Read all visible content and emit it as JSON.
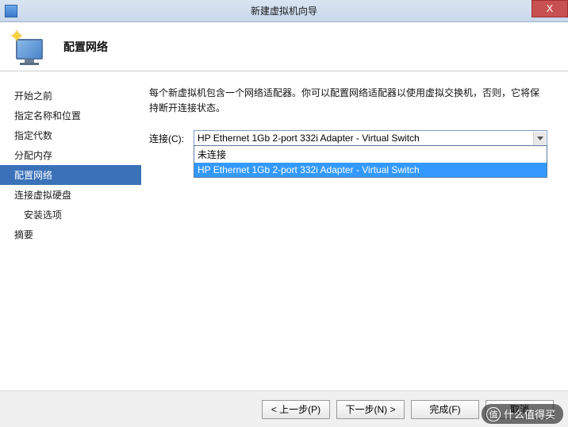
{
  "titlebar": {
    "title": "新建虚拟机向导",
    "close": "X"
  },
  "header": {
    "title": "配置网络"
  },
  "sidebar": {
    "items": [
      {
        "label": "开始之前",
        "indent": false,
        "active": false
      },
      {
        "label": "指定名称和位置",
        "indent": false,
        "active": false
      },
      {
        "label": "指定代数",
        "indent": false,
        "active": false
      },
      {
        "label": "分配内存",
        "indent": false,
        "active": false
      },
      {
        "label": "配置网络",
        "indent": false,
        "active": true
      },
      {
        "label": "连接虚拟硬盘",
        "indent": false,
        "active": false
      },
      {
        "label": "安装选项",
        "indent": true,
        "active": false
      },
      {
        "label": "摘要",
        "indent": false,
        "active": false
      }
    ]
  },
  "main": {
    "description": "每个新虚拟机包含一个网络适配器。你可以配置网络适配器以使用虚拟交换机，否则，它将保持断开连接状态。",
    "connection_label": "连接(C):",
    "connection_value": "HP Ethernet 1Gb 2-port 332i Adapter - Virtual Switch",
    "dropdown_options": [
      {
        "label": "未连接",
        "selected": false
      },
      {
        "label": "HP Ethernet 1Gb 2-port 332i Adapter - Virtual Switch",
        "selected": true
      }
    ]
  },
  "footer": {
    "prev": "< 上一步(P)",
    "next": "下一步(N) >",
    "finish": "完成(F)",
    "cancel": "取消"
  },
  "watermark": {
    "icon": "值",
    "text": "什么值得买"
  }
}
